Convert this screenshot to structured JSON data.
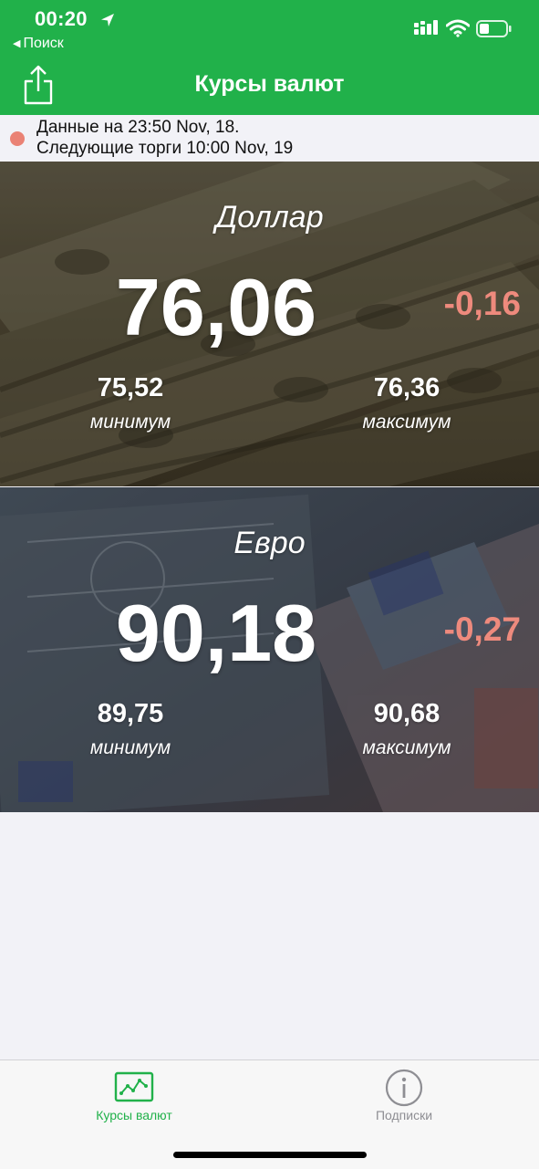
{
  "status_bar": {
    "time": "00:20",
    "back_label": "Поиск"
  },
  "header": {
    "title": "Курсы валют"
  },
  "info": {
    "data_line": "Данные на 23:50 Nov, 18.",
    "next_line": "Следующие торги 10:00 Nov, 19",
    "status_color": "#ea8275"
  },
  "currencies": [
    {
      "name": "Доллар",
      "rate": "76,06",
      "change": "-0,16",
      "min_value": "75,52",
      "min_label": "минимум",
      "max_value": "76,36",
      "max_label": "максимум"
    },
    {
      "name": "Евро",
      "rate": "90,18",
      "change": "-0,27",
      "min_value": "89,75",
      "min_label": "минимум",
      "max_value": "90,68",
      "max_label": "максимум"
    }
  ],
  "tabs": [
    {
      "label": "Курсы валют",
      "icon": "chart-icon",
      "active": true
    },
    {
      "label": "Подписки",
      "icon": "info-icon",
      "active": false
    }
  ],
  "colors": {
    "brand_green": "#21b14a",
    "change_negative": "#ee8a7d",
    "tab_inactive": "#8e8e93"
  }
}
